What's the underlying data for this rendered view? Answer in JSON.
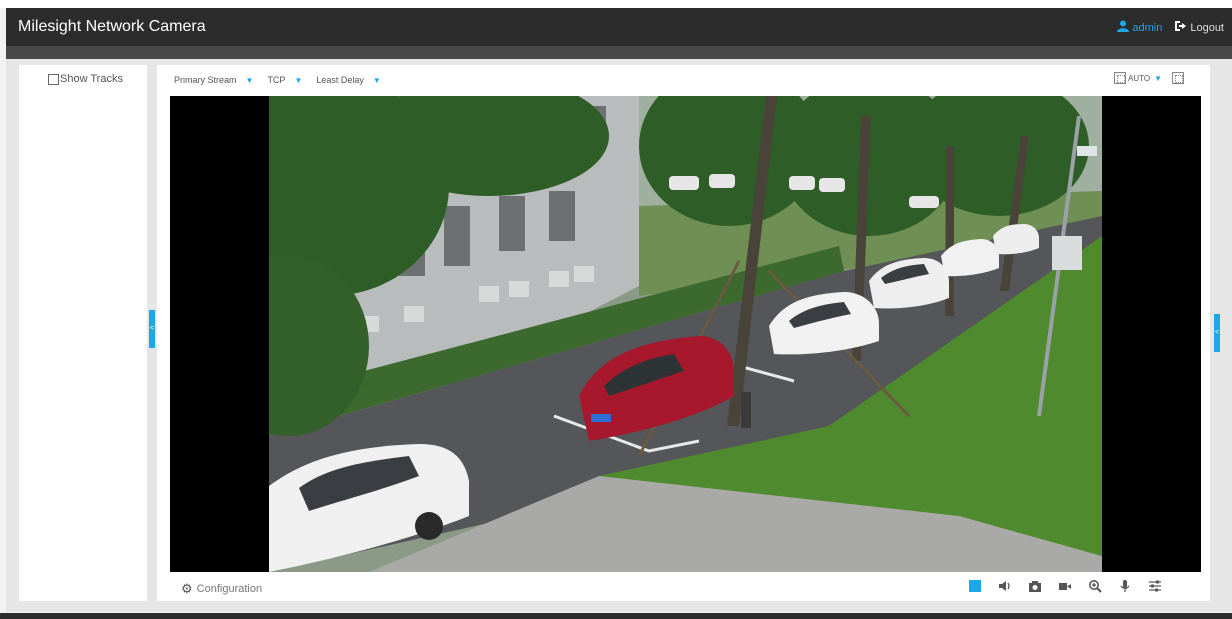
{
  "header": {
    "title": "Milesight Network Camera",
    "user_label": "admin",
    "logout_label": "Logout"
  },
  "left_panel": {
    "show_tracks_label": "Show Tracks",
    "show_tracks_checked": false
  },
  "stream_options": {
    "stream": "Primary Stream",
    "protocol": "TCP",
    "delay": "Least Delay"
  },
  "ratio_options": {
    "ratio": "AUTO"
  },
  "bottom_toolbar": {
    "config_label": "Configuration",
    "controls": [
      "stop-icon",
      "audio-icon",
      "snapshot-icon",
      "record-icon",
      "zoom-icon",
      "microphone-icon",
      "settings-sliders-icon"
    ]
  },
  "colors": {
    "accent": "#1ea7e6",
    "header_bg": "#2c2c2c"
  }
}
